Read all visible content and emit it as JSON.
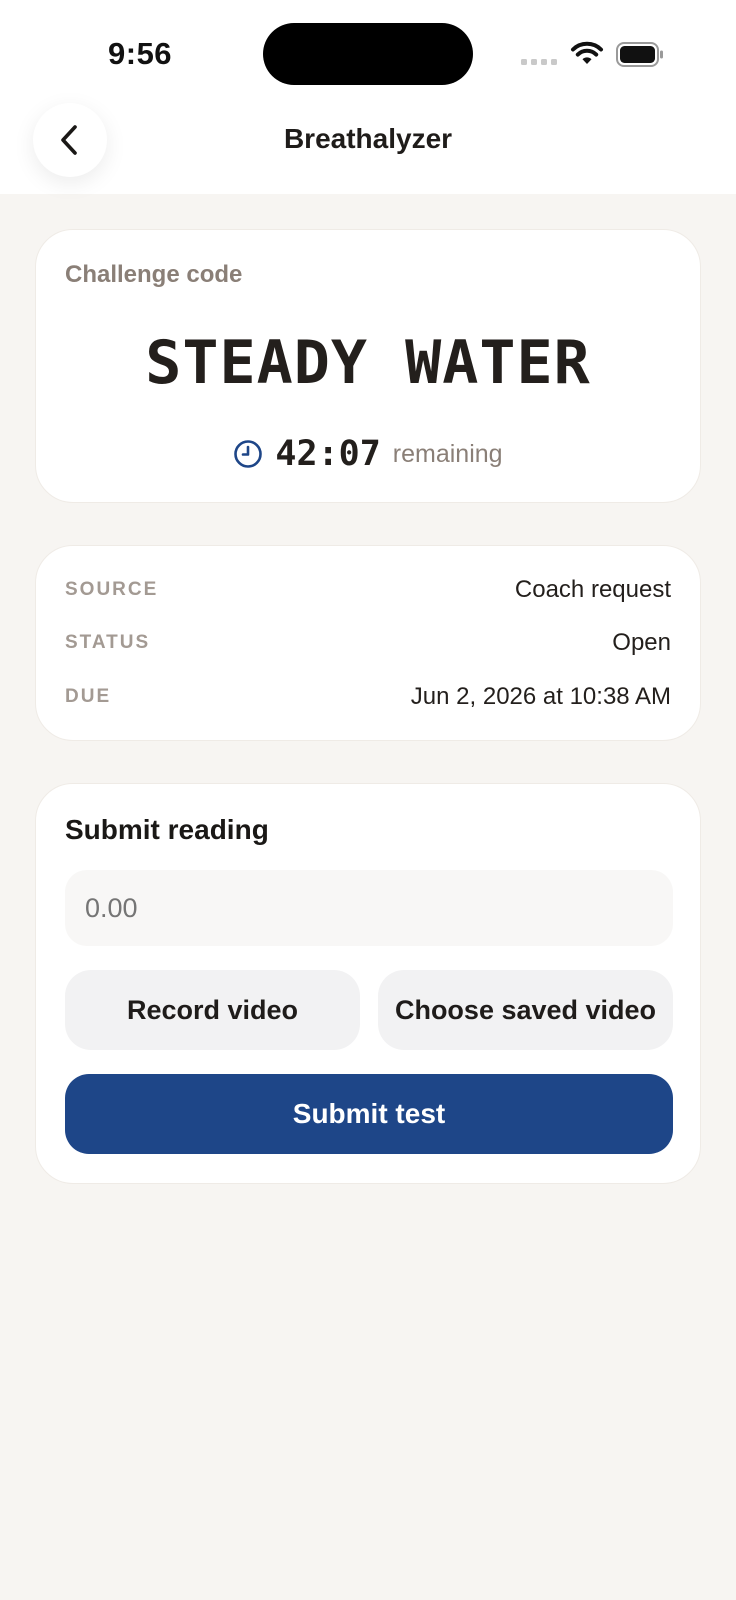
{
  "status_bar": {
    "time": "9:56"
  },
  "nav": {
    "title": "Breathalyzer"
  },
  "challenge": {
    "label": "Challenge code",
    "code": "STEADY WATER",
    "timer": "42:07",
    "timer_suffix": "remaining"
  },
  "details": {
    "rows": [
      {
        "label": "SOURCE",
        "value": "Coach request"
      },
      {
        "label": "STATUS",
        "value": "Open"
      },
      {
        "label": "DUE",
        "value": "Jun 2, 2026 at 10:38 AM"
      }
    ]
  },
  "submit": {
    "title": "Submit reading",
    "input_placeholder": "0.00",
    "record_label": "Record video",
    "choose_label": "Choose saved video",
    "submit_label": "Submit test"
  },
  "colors": {
    "accent": "#1e4688",
    "background": "#f7f5f2",
    "muted_text": "#8a7f77"
  },
  "icons": [
    "chevron-left-icon",
    "clock-icon",
    "wifi-icon",
    "battery-icon",
    "cellular-signal-icon"
  ]
}
